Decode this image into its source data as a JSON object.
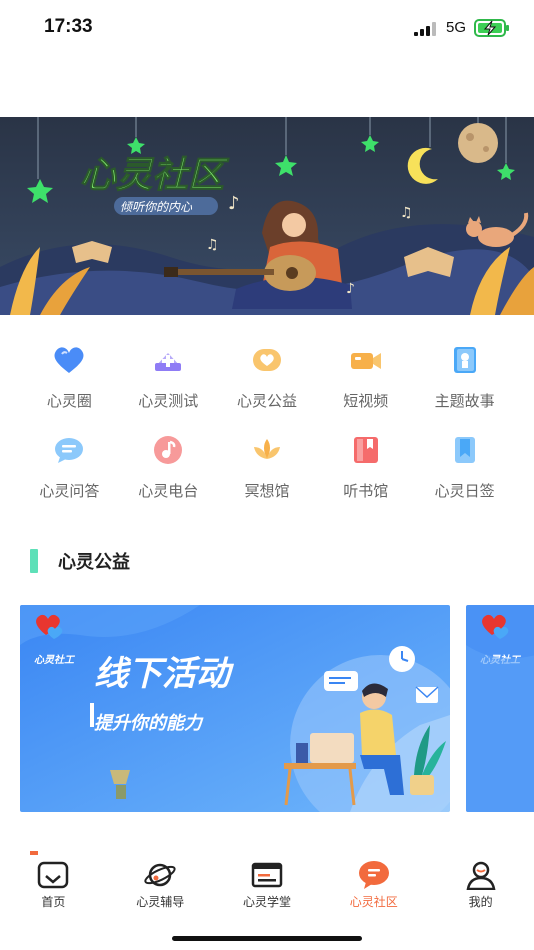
{
  "status_bar": {
    "time": "17:33",
    "network": "5G"
  },
  "banner": {
    "title": "心灵社区",
    "subtitle": "倾听你的内心"
  },
  "features": [
    {
      "label": "心灵圈",
      "icon": "heart-icon",
      "color": "#4a8cf7"
    },
    {
      "label": "心灵测试",
      "icon": "add-card-icon",
      "color": "#8f7cf5"
    },
    {
      "label": "心灵公益",
      "icon": "heart-badge-icon",
      "color": "#f7b04a"
    },
    {
      "label": "短视频",
      "icon": "video-camera-icon",
      "color": "#f7b04a"
    },
    {
      "label": "主题故事",
      "icon": "book-badge-icon",
      "color": "#4aa8f7"
    },
    {
      "label": "心灵问答",
      "icon": "chat-bubble-icon",
      "color": "#4aa8f7"
    },
    {
      "label": "心灵电台",
      "icon": "music-note-icon",
      "color": "#f56b6b"
    },
    {
      "label": "冥想馆",
      "icon": "lotus-icon",
      "color": "#f7b04a"
    },
    {
      "label": "听书馆",
      "icon": "book-icon",
      "color": "#f56b6b"
    },
    {
      "label": "心灵日签",
      "icon": "bookmark-icon",
      "color": "#4aa8f7"
    }
  ],
  "section": {
    "title": "心灵公益"
  },
  "cards": [
    {
      "logo_text": "心灵社工",
      "headline": "线下活动",
      "tagline": "提升你的能力"
    },
    {
      "logo_text": "心灵社工"
    }
  ],
  "tabbar": {
    "active": "心灵社区",
    "items": [
      {
        "label": "首页",
        "icon": "home-icon"
      },
      {
        "label": "心灵辅导",
        "icon": "planet-icon"
      },
      {
        "label": "心灵学堂",
        "icon": "document-icon"
      },
      {
        "label": "心灵社区",
        "icon": "chat-icon"
      },
      {
        "label": "我的",
        "icon": "user-icon"
      }
    ]
  },
  "colors": {
    "accent": "#f26a3d",
    "section_bar": "#5ee0b8",
    "card_blue": "#3d8ef5",
    "banner_bg": "#2f3a4d"
  }
}
